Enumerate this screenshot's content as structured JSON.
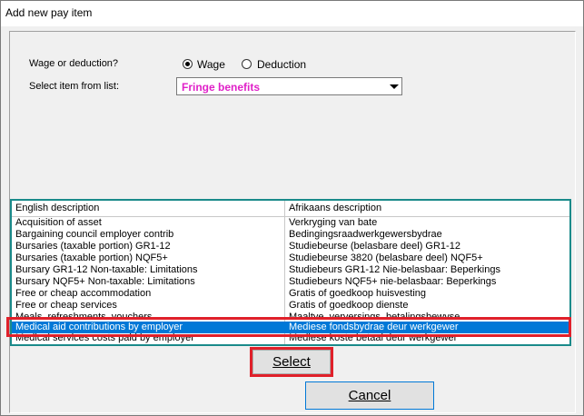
{
  "window": {
    "title": "Add new pay item"
  },
  "form": {
    "wage_or_deduction_label": "Wage or deduction?",
    "options": [
      {
        "label": "Wage",
        "selected": true
      },
      {
        "label": "Deduction",
        "selected": false
      }
    ],
    "select_item_label": "Select item from list:",
    "item_selected": "Fringe benefits"
  },
  "list": {
    "columns": [
      "English description",
      "Afrikaans description"
    ],
    "rows": [
      {
        "en": "Acquisition of asset",
        "af": "Verkryging van bate"
      },
      {
        "en": "Bargaining council employer contrib",
        "af": "Bedingingsraadwerkgewersbydrae"
      },
      {
        "en": "Bursaries (taxable portion) GR1-12",
        "af": "Studiebeurse (belasbare deel) GR1-12"
      },
      {
        "en": "Bursaries (taxable portion) NQF5+",
        "af": "Studiebeurse 3820 (belasbare deel) NQF5+"
      },
      {
        "en": "Bursary GR1-12 Non-taxable: Limitations",
        "af": "Studiebeurs GR1-12 Nie-belasbaar: Beperkings"
      },
      {
        "en": "Bursary NQF5+ Non-taxable: Limitations",
        "af": "Studiebeurs NQF5+ nie-belasbaar: Beperkings"
      },
      {
        "en": "Free or cheap accommodation",
        "af": "Gratis of goedkoop huisvesting"
      },
      {
        "en": "Free or cheap services",
        "af": "Gratis of goedkoop dienste"
      },
      {
        "en": "Meals, refreshments, vouchers",
        "af": "Maaltye, verversings, betalingsbewyse"
      },
      {
        "en": "Medical aid contributions by employer",
        "af": "Mediese fondsbydrae deur werkgewer",
        "selected": true
      },
      {
        "en": "Medical services costs paid by employer",
        "af": "Mediese koste betaal deur werkgewer"
      }
    ]
  },
  "buttons": {
    "select": "Select",
    "cancel": "Cancel"
  },
  "colors": {
    "selection": "#0078d7",
    "highlight_frame": "#e0202a",
    "combo_text": "#e020c8",
    "list_border": "#1a8a8a"
  }
}
